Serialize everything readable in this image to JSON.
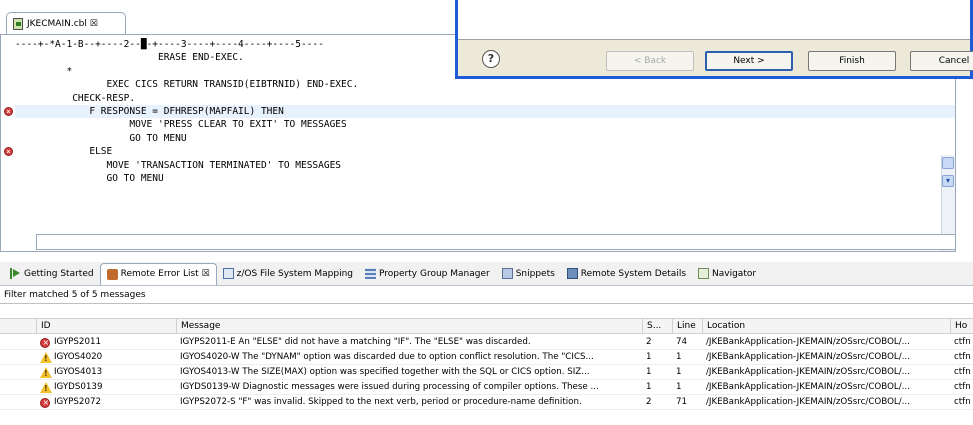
{
  "editor": {
    "tab_label": "JKECMAIN.cbl ☒",
    "ruler": "----+-*A-1-B--+----2--█-+----3----+----4----+----5----",
    "lines": [
      {
        "text": "                         ERASE END-EXEC.",
        "err": false,
        "hl": false
      },
      {
        "text": "         *",
        "err": false,
        "hl": false
      },
      {
        "text": "                EXEC CICS RETURN TRANSID(EIBTRNID) END-EXEC.",
        "err": false,
        "hl": false
      },
      {
        "text": "          CHECK-RESP.",
        "err": false,
        "hl": false
      },
      {
        "text": "             F RESPONSE = DFHRESP(MAPFAIL) THEN",
        "err": true,
        "hl": true
      },
      {
        "text": "                    MOVE 'PRESS CLEAR TO EXIT' TO MESSAGES",
        "err": false,
        "hl": false
      },
      {
        "text": "                    GO TO MENU",
        "err": false,
        "hl": false
      },
      {
        "text": "             ELSE",
        "err": true,
        "hl": false
      },
      {
        "text": "                MOVE 'TRANSACTION TERMINATED' TO MESSAGES",
        "err": false,
        "hl": false
      },
      {
        "text": "                GO TO MENU",
        "err": false,
        "hl": false
      }
    ]
  },
  "wizard": {
    "help": "?",
    "back": "< Back",
    "next": "Next >",
    "finish": "Finish",
    "cancel": "Cancel"
  },
  "views": {
    "tabs": [
      {
        "label": "Getting Started",
        "icon": "play-icon",
        "active": false
      },
      {
        "label": "Remote Error List ☒",
        "icon": "remote-error-list-icon",
        "active": true
      },
      {
        "label": "z/OS File System Mapping",
        "icon": "file-mapping-icon",
        "active": false
      },
      {
        "label": "Property Group Manager",
        "icon": "property-group-icon",
        "active": false
      },
      {
        "label": "Snippets",
        "icon": "snippets-icon",
        "active": false
      },
      {
        "label": "Remote System Details",
        "icon": "remote-system-icon",
        "active": false
      },
      {
        "label": "Navigator",
        "icon": "navigator-icon",
        "active": false
      }
    ]
  },
  "filter_text": "Filter matched 5 of 5 messages",
  "table": {
    "headers": [
      "ID",
      "Message",
      "S...",
      "Line",
      "Location",
      "Ho"
    ],
    "rows": [
      {
        "sev": "error",
        "id": "IGYPS2011",
        "message": "IGYPS2011-E An \"ELSE\" did not have a matching \"IF\".  The \"ELSE\" was discarded.",
        "s": "2",
        "line": "74",
        "location": "/JKEBankApplication-JKEMAIN/zOSsrc/COBOL/...",
        "host": "ctfn"
      },
      {
        "sev": "warning",
        "id": "IGYOS4020",
        "message": "IGYOS4020-W The \"DYNAM\" option was discarded due to option conflict resolution.  The \"CICS...",
        "s": "1",
        "line": "1",
        "location": "/JKEBankApplication-JKEMAIN/zOSsrc/COBOL/...",
        "host": "ctfn"
      },
      {
        "sev": "warning",
        "id": "IGYOS4013",
        "message": "IGYOS4013-W The SIZE(MAX) option was specified together with the SQL or CICS option.  SIZ...",
        "s": "1",
        "line": "1",
        "location": "/JKEBankApplication-JKEMAIN/zOSsrc/COBOL/...",
        "host": "ctfn"
      },
      {
        "sev": "warning",
        "id": "IGYDS0139",
        "message": "IGYDS0139-W Diagnostic messages were issued during processing of compiler options.  These ...",
        "s": "1",
        "line": "1",
        "location": "/JKEBankApplication-JKEMAIN/zOSsrc/COBOL/...",
        "host": "ctfn"
      },
      {
        "sev": "error",
        "id": "IGYPS2072",
        "message": "IGYPS2072-S \"F\" was invalid.  Skipped to the next verb, period or procedure-name definition.",
        "s": "2",
        "line": "71",
        "location": "/JKEBankApplication-JKEMAIN/zOSsrc/COBOL/...",
        "host": "ctfn"
      }
    ]
  }
}
